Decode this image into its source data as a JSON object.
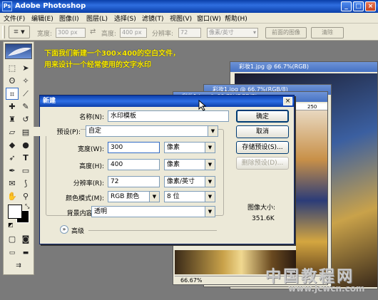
{
  "app_title": "Adobe Photoshop",
  "window_controls": {
    "minimize": "_",
    "maximize": "□",
    "close": "×"
  },
  "menu": [
    "文件(F)",
    "编辑(E)",
    "图像(I)",
    "图层(L)",
    "选择(S)",
    "滤镜(T)",
    "视图(V)",
    "窗口(W)",
    "帮助(H)"
  ],
  "options_bar": {
    "width_label": "宽度:",
    "width_value": "300 px",
    "height_label": "高度:",
    "height_value": "400 px",
    "resolution_label": "分辨率:",
    "resolution_value": "72",
    "unit": "像素/英寸",
    "front_image_button": "前面的图像",
    "clear_button": "清除"
  },
  "tutorial_note": {
    "line1": "下面我们新建一个300×400的空白文件，",
    "line2": "用来设计一个经常使用的文字水印"
  },
  "documents": {
    "back_title": "彩妆1.jpg @ 66.7%(RGB)",
    "front_title": "彩妆1.jpg @ 66.7%(RGB/8)",
    "ruler_mark": "250",
    "zoom": "66.67%"
  },
  "dialog": {
    "title": "新建",
    "name_label": "名称(N):",
    "name_value": "水印模板",
    "preset_label": "预设(P):",
    "preset_value": "自定",
    "width_label": "宽度(W):",
    "width_value": "300",
    "width_unit": "像素",
    "height_label": "高度(H):",
    "height_value": "400",
    "height_unit": "像素",
    "resolution_label": "分辨率(R):",
    "resolution_value": "72",
    "resolution_unit": "像素/英寸",
    "color_mode_label": "颜色模式(M):",
    "color_mode_value": "RGB 颜色",
    "bit_depth_value": "8 位",
    "background_label": "背景内容(C):",
    "background_value": "透明",
    "advanced_label": "高级",
    "ok_button": "确定",
    "cancel_button": "取消",
    "save_preset_button": "存储预设(S)...",
    "delete_preset_button": "删除预设(D)...",
    "image_size_label": "图像大小:",
    "image_size_value": "351.6K"
  },
  "watermark": {
    "text": "中国教程网",
    "url": "www.jcwcn.com"
  },
  "colors": {
    "titlebar": "#0a3fa8",
    "chrome": "#ece9d8",
    "workspace": "#7a7a7a",
    "note": "#ffef00"
  }
}
